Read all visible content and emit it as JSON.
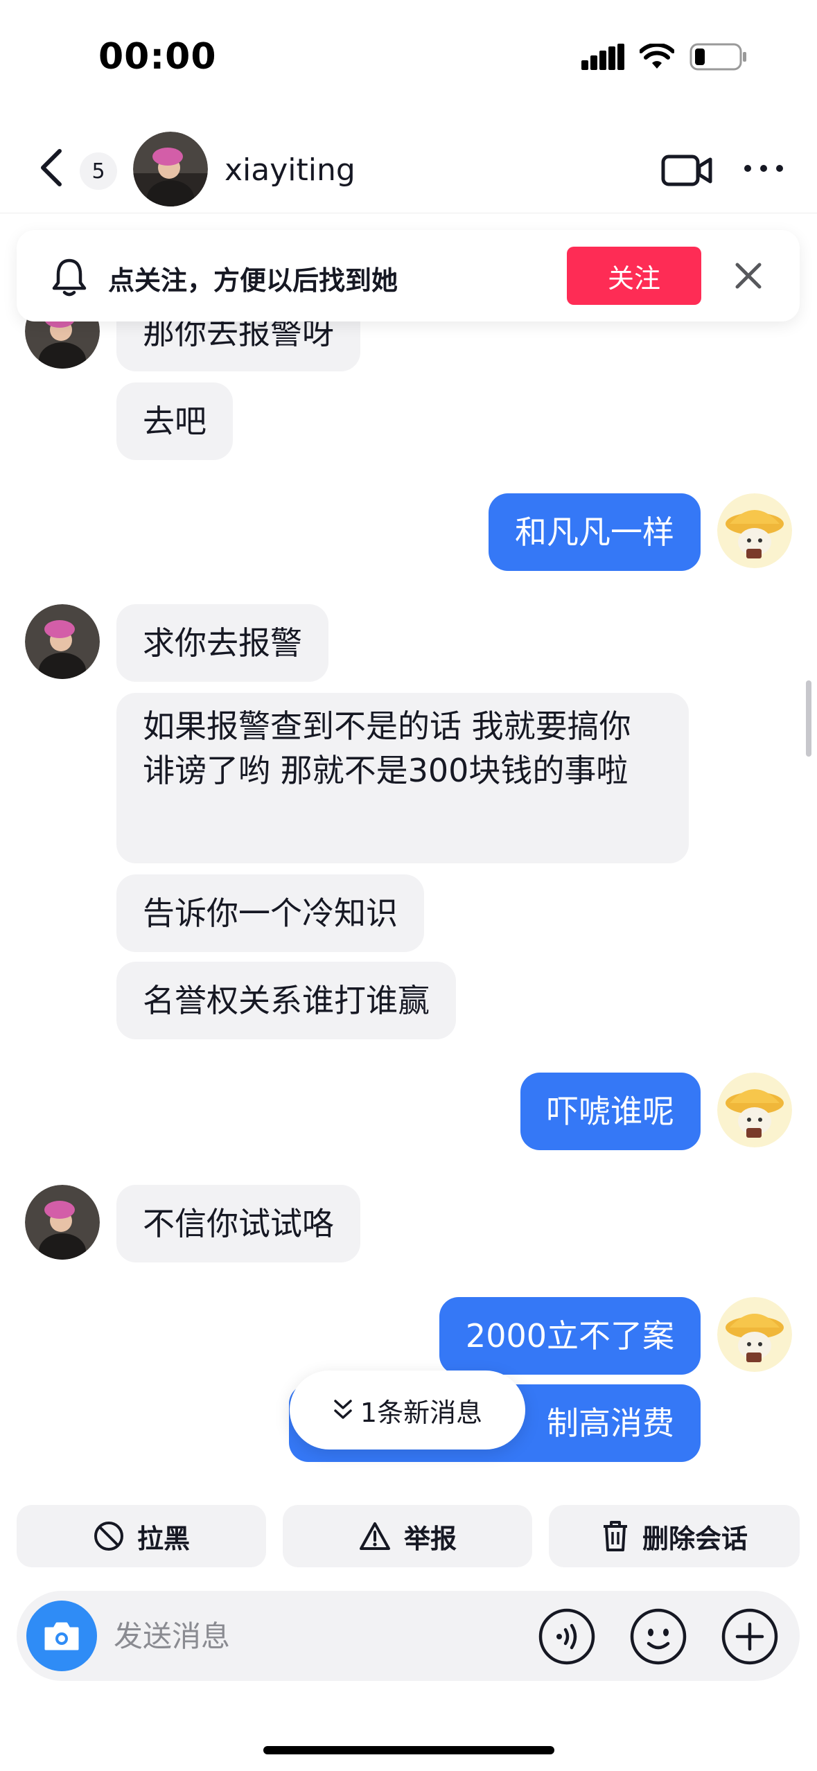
{
  "status_bar": {
    "time": "00:00"
  },
  "header": {
    "unread_count": "5",
    "contact_name": "xiayiting"
  },
  "follow_prompt": {
    "text": "点关注，方便以后找到她",
    "button_label": "关注"
  },
  "messages": [
    {
      "side": "in",
      "text": "那你去报警呀"
    },
    {
      "side": "in",
      "text": "去吧"
    },
    {
      "side": "out",
      "text": "和凡凡一样"
    },
    {
      "side": "in",
      "text": "求你去报警"
    },
    {
      "side": "in",
      "text": "如果报警查到不是的话 我就要搞你诽谤了哟  那就不是300块钱的事啦"
    },
    {
      "side": "in",
      "text": "告诉你一个冷知识"
    },
    {
      "side": "in",
      "text": "名誉权关系谁打谁赢"
    },
    {
      "side": "out",
      "text": "吓唬谁呢"
    },
    {
      "side": "in",
      "text": "不信你试试咯"
    },
    {
      "side": "out",
      "text": "2000立不了案"
    },
    {
      "side": "out",
      "text": "制高消费"
    }
  ],
  "new_message_pill": {
    "label": "1条新消息"
  },
  "actions": {
    "block_label": "拉黑",
    "report_label": "举报",
    "delete_label": "删除会话"
  },
  "input": {
    "placeholder": "发送消息"
  },
  "colors": {
    "accent_red": "#fe2c55",
    "outgoing_bubble": "#3578f6",
    "incoming_bubble": "#f2f2f4",
    "camera_blue": "#2f8cf6"
  }
}
